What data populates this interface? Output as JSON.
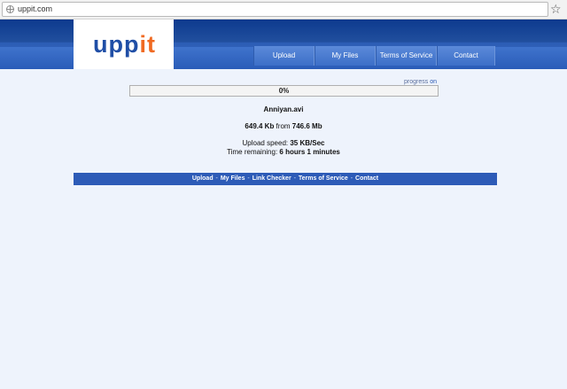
{
  "browser": {
    "url": "uppit.com",
    "url_icon": "globe-icon",
    "bookmark_icon": "star-icon",
    "bookmark_glyph": "☆"
  },
  "site": {
    "logo_main": "upp",
    "logo_accent": "it",
    "colors": {
      "brand_blue": "#1f4ea6",
      "brand_orange": "#f06a22",
      "bar_blue": "#2d5bb7"
    }
  },
  "nav": [
    {
      "label": "Upload"
    },
    {
      "label": "My Files"
    },
    {
      "label": "Terms of Service"
    },
    {
      "label": "Contact"
    }
  ],
  "progress": {
    "label_prefix": "progress ",
    "label_on": "on",
    "percent_text": "0%",
    "fraction": 0.0
  },
  "upload": {
    "file_name": "Anniyan.avi",
    "uploaded": "649.4 Kb",
    "from_word": " from ",
    "total": "746.6 Mb",
    "speed_label": "Upload speed: ",
    "speed_value": "35 KB/Sec",
    "time_label": "Time remaining: ",
    "time_value": "6 hours 1 minutes"
  },
  "footer": {
    "separator": " - ",
    "links": [
      "Upload",
      "My Files",
      "Link Checker",
      "Terms of Service",
      "Contact"
    ]
  }
}
